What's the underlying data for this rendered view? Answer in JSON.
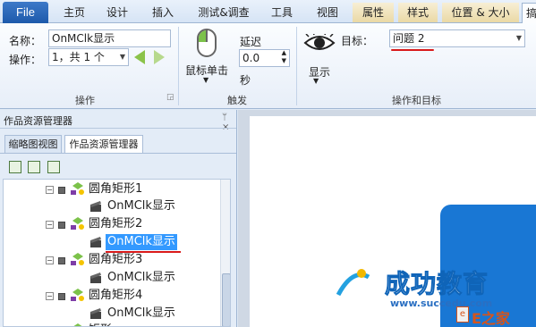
{
  "tabs": {
    "file": "File",
    "home": "主页",
    "design": "设计",
    "insert": "插入",
    "test": "测试&调查",
    "tools": "工具",
    "view": "视图",
    "properties": "属性",
    "style": "样式",
    "position": "位置 & 大小",
    "last": "搞"
  },
  "action_group": {
    "name_label": "名称：",
    "name_value": "OnMClk显示",
    "op_label": "操作：",
    "op_value": "1，共 1 个",
    "group_label": "操作"
  },
  "trigger_group": {
    "mouse_label": "鼠标单击",
    "delay_label": "延迟",
    "delay_value": "0.0",
    "seconds": "秒",
    "group_label": "触发"
  },
  "target_group": {
    "show_label": "显示",
    "target_label": "目标：",
    "target_value": "问题 2",
    "group_label": "操作和目标"
  },
  "panel": {
    "title": "作品资源管理器",
    "tab_thumb": "缩略图视图",
    "tab_explorer": "作品资源管理器",
    "tree": [
      {
        "label": "圆角矩形1",
        "kind": "shape"
      },
      {
        "label": "OnMClk显示",
        "kind": "event"
      },
      {
        "label": "圆角矩形2",
        "kind": "shape"
      },
      {
        "label": "OnMClk显示",
        "kind": "event",
        "selected": true
      },
      {
        "label": "圆角矩形3",
        "kind": "shape"
      },
      {
        "label": "OnMClk显示",
        "kind": "event"
      },
      {
        "label": "圆角矩形4",
        "kind": "shape"
      },
      {
        "label": "OnMClk显示",
        "kind": "event"
      },
      {
        "label": "矩形",
        "kind": "shape"
      }
    ]
  },
  "watermark": {
    "brand": "成功教育",
    "url": "www.succedu.com",
    "corner": "E之家"
  },
  "colors": {
    "accent": "#1d5aab",
    "selected": "#3399ff",
    "underline": "#d91a1a",
    "slide_shape": "#1977d4"
  }
}
